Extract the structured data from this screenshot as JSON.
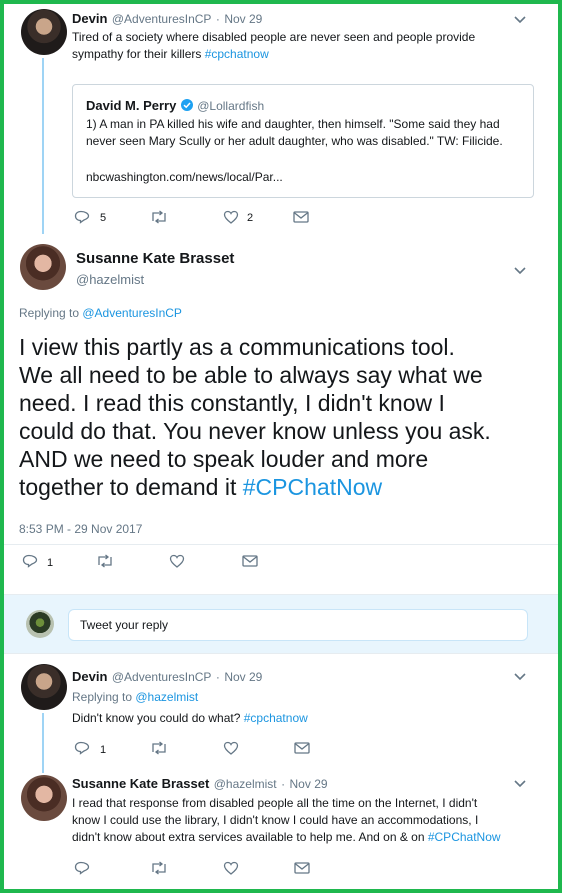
{
  "tweet1": {
    "name": "Devin",
    "handle": "@AdventuresInCP",
    "date": "Nov 29",
    "text_line1": "Tired of a society where disabled people are never seen and people provide",
    "text_line2": "sympathy for their killers ",
    "hashtag": "#cpchatnow",
    "replies": "5",
    "likes": "2"
  },
  "quoted": {
    "name": "David M. Perry",
    "handle": "@Lollardfish",
    "line1": "1) A man in PA killed his wife and daughter, then himself. \"Some said they had",
    "line2": "never seen Mary Scully or her adult daughter, who was disabled.\" TW: Filicide.",
    "link": "nbcwashington.com/news/local/Par..."
  },
  "main": {
    "name": "Susanne Kate Brasset",
    "handle": "@hazelmist",
    "replying_prefix": "Replying to ",
    "replying_to": "@AdventuresInCP",
    "lines": [
      "I view this partly as a communications tool.",
      "We all need to be able to always say what we",
      "need. I read this constantly, I didn't know I",
      "could do that. You never know unless you ask.",
      "AND we need to speak louder and more",
      "together to demand it "
    ],
    "hashtag": "#CPChatNow",
    "timestamp": "8:53 PM - 29 Nov 2017",
    "replies": "1"
  },
  "compose": {
    "placeholder": "Tweet your reply"
  },
  "reply1": {
    "name": "Devin",
    "handle": "@AdventuresInCP",
    "date": "Nov 29",
    "replying_prefix": "Replying to ",
    "replying_to": "@hazelmist",
    "text": "Didn't know you could do what? ",
    "hashtag": "#cpchatnow",
    "replies": "1"
  },
  "reply2": {
    "name": "Susanne Kate Brasset",
    "handle": "@hazelmist",
    "date": "Nov 29",
    "line1": "I read that response from disabled people all the time on the Internet, I didn't",
    "line2": "know I could use the library, I didn't know I could have an accommodations, I",
    "line3": "didn't know about extra services available to help me. And on & on ",
    "hashtag": "#CPChatNow"
  },
  "colors": {
    "border": "#1fb84e",
    "link": "#1b95e0",
    "thread": "#9fd4f5"
  }
}
